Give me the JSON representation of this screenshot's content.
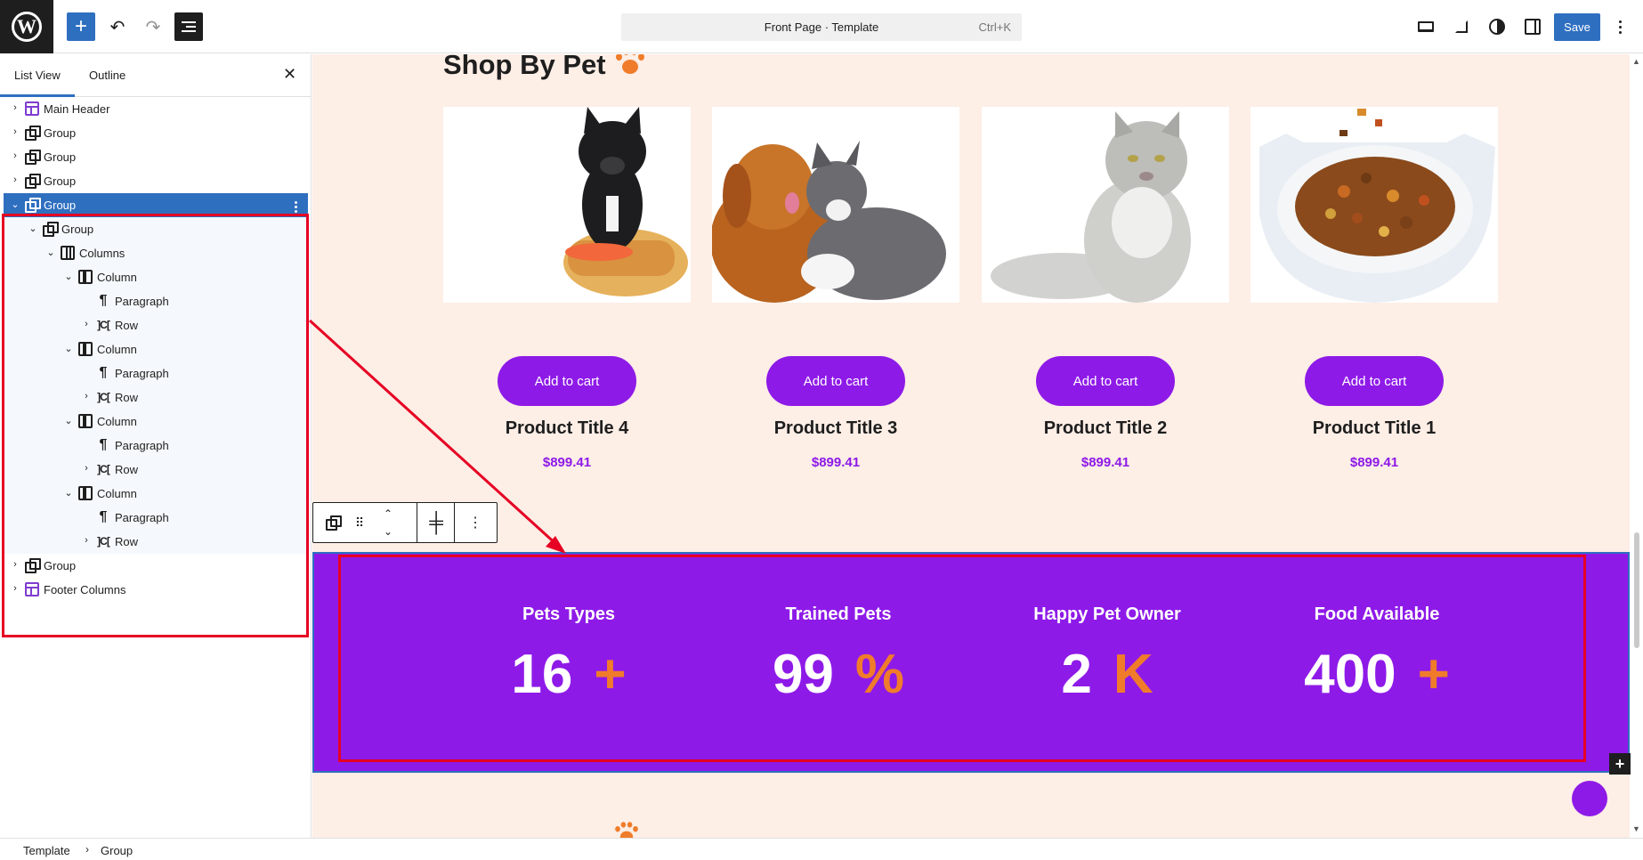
{
  "header": {
    "document_title": "Front Page · Template",
    "shortcut": "Ctrl+K",
    "save_label": "Save"
  },
  "sidebar": {
    "tabs": [
      "List View",
      "Outline"
    ],
    "tree": [
      {
        "label": "Main Header",
        "icon": "template-part-icon",
        "expander": "collapsed"
      },
      {
        "label": "Group",
        "icon": "group-icon",
        "expander": "collapsed"
      },
      {
        "label": "Group",
        "icon": "group-icon",
        "expander": "collapsed"
      },
      {
        "label": "Group",
        "icon": "group-icon",
        "expander": "collapsed"
      },
      {
        "label": "Group",
        "icon": "group-icon",
        "expander": "expanded",
        "selected": true
      },
      {
        "label": "Group",
        "icon": "group-icon",
        "expander": "expanded"
      },
      {
        "label": "Columns",
        "icon": "columns-icon",
        "expander": "expanded"
      },
      {
        "label": "Column",
        "icon": "column-icon",
        "expander": "expanded"
      },
      {
        "label": "Paragraph",
        "icon": "paragraph-icon",
        "expander": "none"
      },
      {
        "label": "Row",
        "icon": "row-icon",
        "expander": "collapsed"
      },
      {
        "label": "Column",
        "icon": "column-icon",
        "expander": "expanded"
      },
      {
        "label": "Paragraph",
        "icon": "paragraph-icon",
        "expander": "none"
      },
      {
        "label": "Row",
        "icon": "row-icon",
        "expander": "collapsed"
      },
      {
        "label": "Column",
        "icon": "column-icon",
        "expander": "expanded"
      },
      {
        "label": "Paragraph",
        "icon": "paragraph-icon",
        "expander": "none"
      },
      {
        "label": "Row",
        "icon": "row-icon",
        "expander": "collapsed"
      },
      {
        "label": "Column",
        "icon": "column-icon",
        "expander": "expanded"
      },
      {
        "label": "Paragraph",
        "icon": "paragraph-icon",
        "expander": "none"
      },
      {
        "label": "Row",
        "icon": "row-icon",
        "expander": "collapsed"
      },
      {
        "label": "Group",
        "icon": "group-icon",
        "expander": "collapsed"
      },
      {
        "label": "Footer Columns",
        "icon": "template-part-icon",
        "expander": "collapsed"
      }
    ]
  },
  "canvas": {
    "section_title": "Shop By Pet",
    "products": [
      {
        "button": "Add to cart",
        "title": "Product Title 4",
        "price": "$899.41",
        "image": "french-bulldog-image"
      },
      {
        "button": "Add to cart",
        "title": "Product Title 3",
        "price": "$899.41",
        "image": "dog-and-cat-image"
      },
      {
        "button": "Add to cart",
        "title": "Product Title 2",
        "price": "$899.41",
        "image": "fluffy-cat-image"
      },
      {
        "button": "Add to cart",
        "title": "Product Title 1",
        "price": "$899.41",
        "image": "pet-food-bowl-image"
      }
    ],
    "stats": [
      {
        "label": "Pets Types",
        "number": "16",
        "suffix": "+"
      },
      {
        "label": "Trained Pets",
        "number": "99",
        "suffix": "%"
      },
      {
        "label": "Happy Pet Owner",
        "number": "2",
        "suffix": "K"
      },
      {
        "label": "Food Available",
        "number": "400",
        "suffix": "+"
      }
    ]
  },
  "breadcrumb": [
    "Template",
    "Group"
  ],
  "colors": {
    "accent_blue": "#2f6fc0",
    "brand_purple": "#8e1ae8",
    "brand_orange": "#f07c2b",
    "canvas_background": "#fdeee6",
    "annotation_red": "#e60023"
  }
}
